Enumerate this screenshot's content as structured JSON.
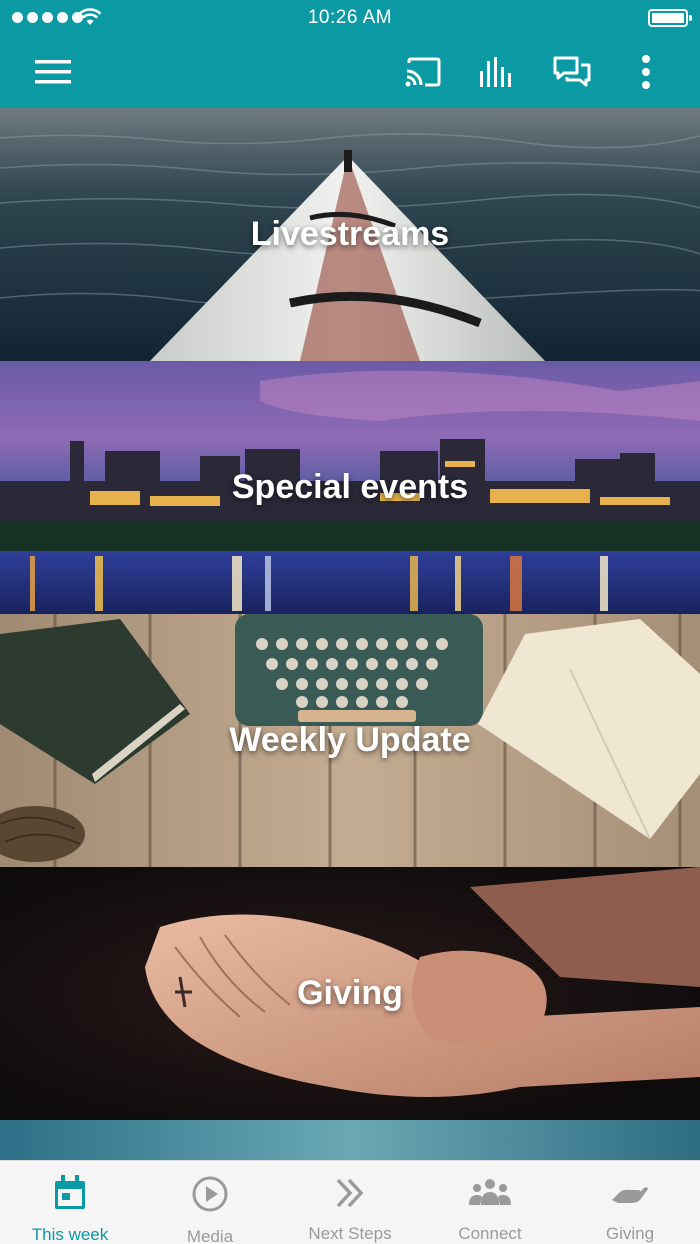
{
  "status_bar": {
    "time": "10:26 AM"
  },
  "toolbar": {
    "menu_icon": "hamburger-menu-icon",
    "actions": [
      "cast-icon",
      "equalizer-icon",
      "chat-icon",
      "more-vertical-icon"
    ]
  },
  "tiles": [
    {
      "label": "Livestreams",
      "image": "kayak-on-lake-photo"
    },
    {
      "label": "Special events",
      "image": "city-skyline-at-dusk-photo"
    },
    {
      "label": "Weekly Update",
      "image": "typewriter-on-wooden-desk-photo"
    },
    {
      "label": "Giving",
      "image": "cupped-hands-photo"
    }
  ],
  "tabs": [
    {
      "label": "This week",
      "icon": "calendar-icon",
      "active": true
    },
    {
      "label": "Media",
      "icon": "play-circle-icon",
      "active": false
    },
    {
      "label": "Next Steps",
      "icon": "double-chevron-icon",
      "active": false
    },
    {
      "label": "Connect",
      "icon": "group-icon",
      "active": false
    },
    {
      "label": "Giving",
      "icon": "giving-hand-icon",
      "active": false
    }
  ],
  "colors": {
    "accent": "#0b9aa3",
    "tab_inactive": "#9a9a9a",
    "tabbar_bg": "#f5f5f5"
  }
}
